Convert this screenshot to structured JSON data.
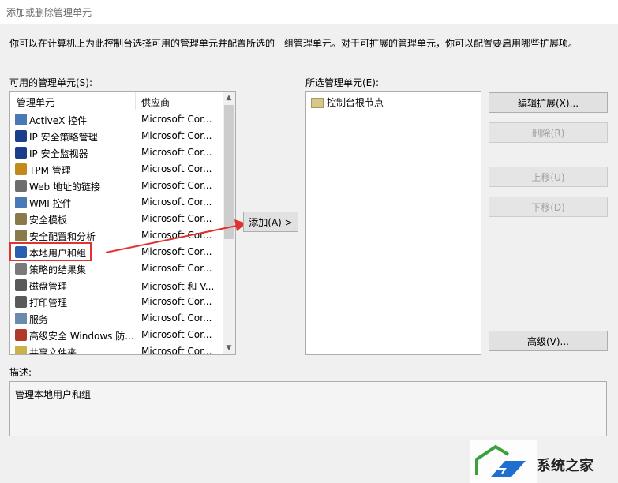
{
  "window": {
    "title": "添加或删除管理单元"
  },
  "intro": "你可以在计算机上为此控制台选择可用的管理单元并配置所选的一组管理单元。对于可扩展的管理单元，你可以配置要启用哪些扩展项。",
  "available": {
    "label": "可用的管理单元(S):",
    "columns": [
      "管理单元",
      "供应商"
    ],
    "items": [
      {
        "name": "ActiveX 控件",
        "vendor": "Microsoft Cor...",
        "icon": "activex-icon"
      },
      {
        "name": "IP 安全策略管理",
        "vendor": "Microsoft Cor...",
        "icon": "ip-security-policy-icon"
      },
      {
        "name": "IP 安全监视器",
        "vendor": "Microsoft Cor...",
        "icon": "ip-security-monitor-icon"
      },
      {
        "name": "TPM 管理",
        "vendor": "Microsoft Cor...",
        "icon": "tpm-icon"
      },
      {
        "name": "Web 地址的链接",
        "vendor": "Microsoft Cor...",
        "icon": "web-link-icon"
      },
      {
        "name": "WMI 控件",
        "vendor": "Microsoft Cor...",
        "icon": "wmi-icon"
      },
      {
        "name": "安全模板",
        "vendor": "Microsoft Cor...",
        "icon": "security-template-icon"
      },
      {
        "name": "安全配置和分析",
        "vendor": "Microsoft Cor...",
        "icon": "security-config-icon"
      },
      {
        "name": "本地用户和组",
        "vendor": "Microsoft Cor...",
        "icon": "users-groups-icon"
      },
      {
        "name": "策略的结果集",
        "vendor": "Microsoft Cor...",
        "icon": "policy-result-icon"
      },
      {
        "name": "磁盘管理",
        "vendor": "Microsoft 和 V...",
        "icon": "disk-management-icon"
      },
      {
        "name": "打印管理",
        "vendor": "Microsoft Cor...",
        "icon": "print-management-icon"
      },
      {
        "name": "服务",
        "vendor": "Microsoft Cor...",
        "icon": "services-icon"
      },
      {
        "name": "高级安全 Windows 防...",
        "vendor": "Microsoft Cor...",
        "icon": "firewall-icon"
      },
      {
        "name": "共享文件夹",
        "vendor": "Microsoft Cor...",
        "icon": "shared-folder-icon"
      }
    ]
  },
  "add_button": "添加(A) >",
  "selected": {
    "label": "所选管理单元(E):",
    "root": "控制台根节点"
  },
  "buttons": {
    "edit_ext": "编辑扩展(X)...",
    "remove": "删除(R)",
    "move_up": "上移(U)",
    "move_down": "下移(D)",
    "advanced": "高级(V)..."
  },
  "description": {
    "label": "描述:",
    "text": "管理本地用户和组"
  },
  "watermark": {
    "text": "系统之家"
  },
  "colors": {
    "highlight": "#e0322e",
    "arrow": "#e0322e"
  }
}
